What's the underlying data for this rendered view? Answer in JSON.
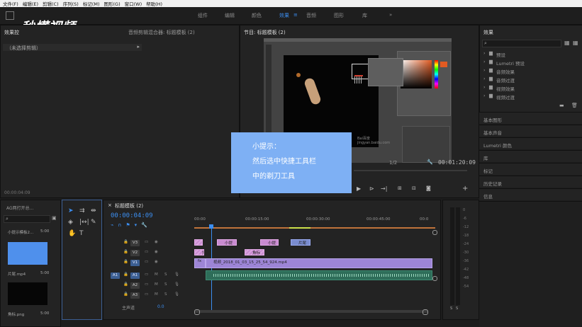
{
  "menu": [
    "文件(F)",
    "编辑(E)",
    "剪辑(C)",
    "序列(S)",
    "标记(M)",
    "图形(G)",
    "窗口(W)",
    "帮助(H)"
  ],
  "logo": "秒懂视频",
  "workspaces": [
    "组件",
    "编辑",
    "颜色",
    "效果",
    "音频",
    "图形",
    "库"
  ],
  "active_workspace": "效果",
  "effects_controls": {
    "title": "效果控",
    "extra_tab": "音频剪辑混合器: 标题模板 (2)",
    "no_clip": "（未选择剪辑）",
    "timecode": "00:00:04:09"
  },
  "program_monitor": {
    "title": "节目: 标题模板 (2)",
    "fit": "1/2",
    "timecode": "00:01:20:09",
    "watermark": "Bai百度 jingyan.baidu.com"
  },
  "tip": {
    "line1": "小提示：",
    "line2": "然后选中快捷工具栏",
    "line3": "中的剃刀工具"
  },
  "project": {
    "title": "AG两打开总...",
    "items": [
      {
        "name": "小提示模板2...",
        "duration": "5:00"
      },
      {
        "name": "片尾.mp4",
        "duration": "5:00"
      },
      {
        "name": "角标.png",
        "duration": "5:00"
      }
    ]
  },
  "timeline": {
    "tab": "标题模板 (2)",
    "timecode": "00:00:04:09",
    "ruler": [
      "00:00",
      "00:00:15:00",
      "00:00:30:00",
      "00:00:45:00",
      "00:0"
    ],
    "tracks": [
      {
        "name": "V3",
        "clips": [
          "小提",
          "小提",
          "片尾"
        ]
      },
      {
        "name": "V2",
        "clips": [
          "角标",
          "角标"
        ]
      },
      {
        "name": "V1",
        "clips": [
          "fx",
          "视频_2018_01_03_15_25_54_924.mp4"
        ]
      },
      {
        "name": "A1"
      },
      {
        "name": "A2"
      },
      {
        "name": "A3"
      }
    ],
    "master": "主声道",
    "master_val": "0.0"
  },
  "effects_panel": {
    "title": "效果",
    "items": [
      "预设",
      "Lumetri 预设",
      "音频效果",
      "音频过渡",
      "视频效果",
      "视频过渡"
    ],
    "sections": [
      "基本图形",
      "基本声音",
      "Lumetri 颜色",
      "库",
      "标记",
      "历史记录",
      "信息"
    ]
  },
  "meter_ticks": [
    "0",
    "-6",
    "-12",
    "-18",
    "-24",
    "-30",
    "-36",
    "-42",
    "-48",
    "-54"
  ],
  "meter_labels": [
    "S",
    "S"
  ],
  "colors": {
    "accent": "#3c8ef0",
    "tip_bg": "#7eb0f4",
    "clip_pink": "#c98bd0",
    "clip_purple": "#9d85d6",
    "clip_audio": "#2e6d59"
  }
}
